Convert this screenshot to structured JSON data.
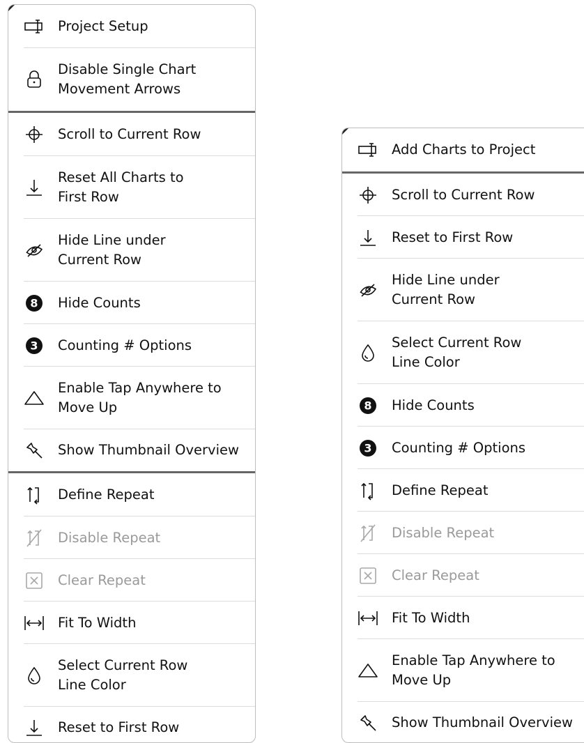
{
  "left_menu": {
    "items": [
      {
        "label": "Project Setup",
        "icon": "project-setup-icon",
        "enabled": true
      },
      {
        "label": "Disable Single Chart\nMovement Arrows",
        "icon": "lock-icon",
        "enabled": true
      },
      {
        "label": "Scroll to Current Row",
        "icon": "crosshair-icon",
        "enabled": true
      },
      {
        "label": "Reset All Charts to\nFirst Row",
        "icon": "arrow-down-to-line-icon",
        "enabled": true
      },
      {
        "label": "Hide Line under\nCurrent Row",
        "icon": "eye-slash-icon",
        "enabled": true
      },
      {
        "label": "Hide Counts",
        "icon": "number-8-badge-icon",
        "enabled": true
      },
      {
        "label": "Counting # Options",
        "icon": "number-3-badge-icon",
        "enabled": true
      },
      {
        "label": "Enable Tap Anywhere to\nMove Up",
        "icon": "triangle-icon",
        "enabled": true
      },
      {
        "label": "Show Thumbnail Overview",
        "icon": "pin-icon",
        "enabled": true
      },
      {
        "label": "Define Repeat",
        "icon": "repeat-brackets-icon",
        "enabled": true
      },
      {
        "label": "Disable Repeat",
        "icon": "repeat-disabled-icon",
        "enabled": false
      },
      {
        "label": "Clear Repeat",
        "icon": "clear-box-icon",
        "enabled": false
      },
      {
        "label": "Fit To Width",
        "icon": "fit-width-icon",
        "enabled": true
      },
      {
        "label": "Select Current Row\nLine Color",
        "icon": "droplet-icon",
        "enabled": true
      },
      {
        "label": "Reset to First Row",
        "icon": "arrow-down-to-line-icon",
        "enabled": true
      }
    ]
  },
  "right_menu": {
    "items": [
      {
        "label": "Add Charts to Project",
        "icon": "project-setup-icon",
        "enabled": true
      },
      {
        "label": "Scroll to Current Row",
        "icon": "crosshair-icon",
        "enabled": true
      },
      {
        "label": "Reset to First Row",
        "icon": "arrow-down-to-line-icon",
        "enabled": true
      },
      {
        "label": "Hide Line under\nCurrent Row",
        "icon": "eye-slash-icon",
        "enabled": true
      },
      {
        "label": "Select Current Row\nLine Color",
        "icon": "droplet-icon",
        "enabled": true
      },
      {
        "label": "Hide Counts",
        "icon": "number-8-badge-icon",
        "enabled": true
      },
      {
        "label": "Counting # Options",
        "icon": "number-3-badge-icon",
        "enabled": true
      },
      {
        "label": "Define Repeat",
        "icon": "repeat-brackets-icon",
        "enabled": true
      },
      {
        "label": "Disable Repeat",
        "icon": "repeat-disabled-icon",
        "enabled": false
      },
      {
        "label": "Clear Repeat",
        "icon": "clear-box-icon",
        "enabled": false
      },
      {
        "label": "Fit To Width",
        "icon": "fit-width-icon",
        "enabled": true
      },
      {
        "label": "Enable Tap Anywhere to\nMove Up",
        "icon": "triangle-icon",
        "enabled": true
      },
      {
        "label": "Show Thumbnail Overview",
        "icon": "pin-icon",
        "enabled": true
      }
    ]
  },
  "colors": {
    "enabled_text": "#111111",
    "disabled_text": "#9a9a9a",
    "separator": "#666666"
  },
  "badges": {
    "eight": "8",
    "three": "3"
  }
}
